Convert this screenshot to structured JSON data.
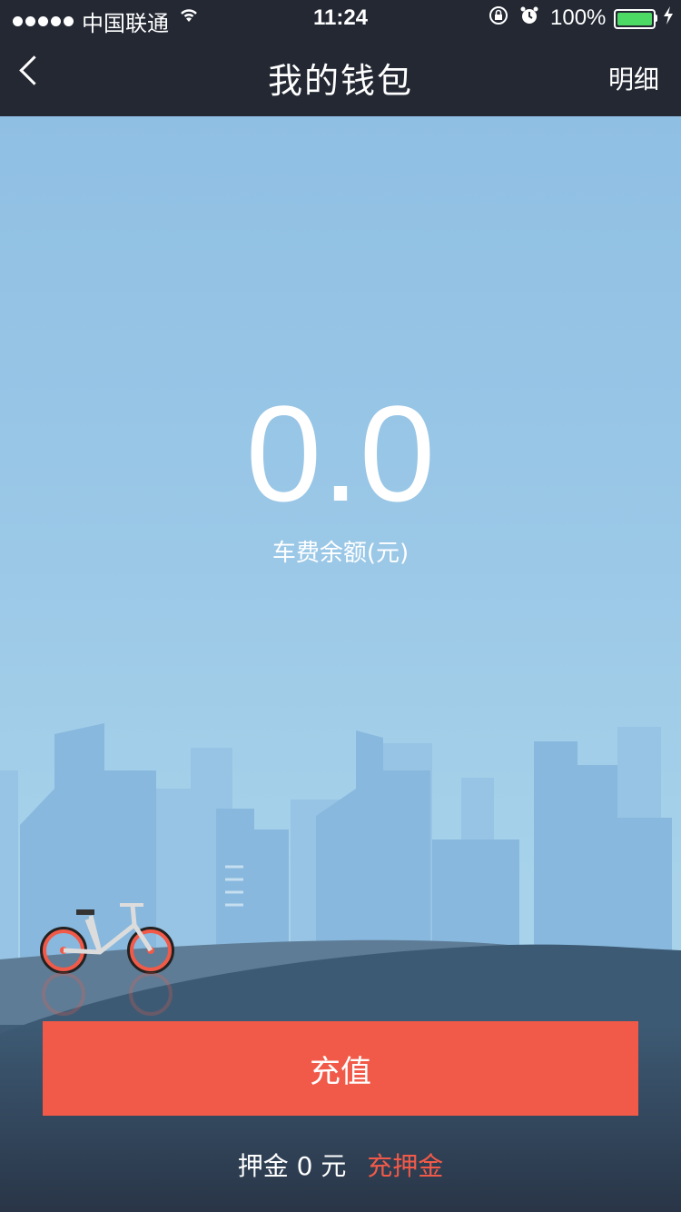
{
  "status_bar": {
    "carrier": "中国联通",
    "time": "11:24",
    "battery_percent": "100%",
    "icons": [
      "signal-dots-icon",
      "wifi-icon",
      "orientation-lock-icon",
      "alarm-icon",
      "battery-icon",
      "charging-bolt-icon"
    ]
  },
  "nav": {
    "title": "我的钱包",
    "right_label": "明细",
    "back_icon": "chevron-left-icon"
  },
  "wallet": {
    "balance": "0.0",
    "balance_label": "车费余额(元)"
  },
  "actions": {
    "recharge_label": "充值",
    "deposit_text": "押金 0 元",
    "deposit_link": "充押金"
  },
  "colors": {
    "accent": "#f15a48",
    "nav_bg": "#232833",
    "sky_top": "#8fbfe3",
    "ground": "#3d5a74"
  }
}
